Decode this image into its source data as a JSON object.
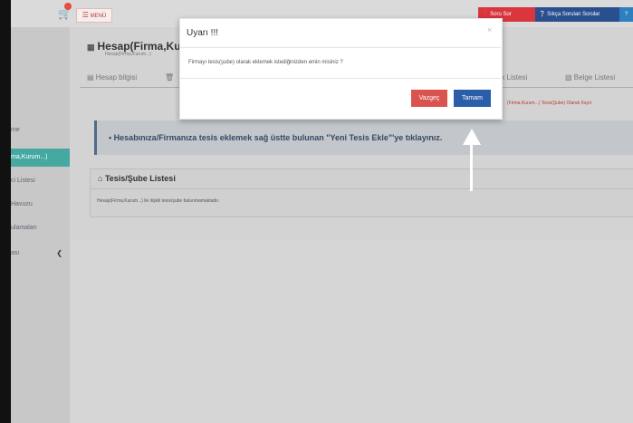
{
  "topbar": {
    "menu_label": "MENÜ",
    "soru_button": "Soru Sor",
    "sss_button": "Sıkça Sorulan Sorular",
    "help_button": "?"
  },
  "sidebar": {
    "items": [
      {
        "label": "me"
      },
      {
        "label": "ma,Kurum...)"
      },
      {
        "label": "ci Listesi"
      },
      {
        "label": "Havuzu"
      },
      {
        "label": "ulamaları"
      },
      {
        "label": "ası"
      }
    ]
  },
  "page": {
    "title": "Hesap(Firma,Ku",
    "subtitle": "Hesap(Firma,Kurum...)"
  },
  "tabs": {
    "hesap": "Hesap bilgisi",
    "islik": "işlik Listesi",
    "belge": "Belge Listesi",
    "breadcrumb_note": "(Firma,Kurum...) Tesis(Şube) Olarak Kayıt"
  },
  "alert": {
    "text": "Hesabınıza/Firmanıza tesis eklemek sağ üstte bulunan \"Yeni Tesis Ekle\"'ye tıklayınız."
  },
  "panel": {
    "title": "Tesis/Şube Listesi",
    "empty_text": "Hesap(Firma,Kurum...) ile ilişkili tesis/şube bulunmamaktadır."
  },
  "modal": {
    "title": "Uyarı !!!",
    "message": "Firmayı tesis(şube) olarak eklemek istediğinizden emin misiniz ?",
    "cancel_label": "Vazgeç",
    "ok_label": "Tamam",
    "close_symbol": "×"
  },
  "colors": {
    "cancel_button": "#d9534f",
    "ok_button": "#2a5ea8",
    "sidebar_active": "#46a9a1",
    "alert_text": "#364860"
  }
}
